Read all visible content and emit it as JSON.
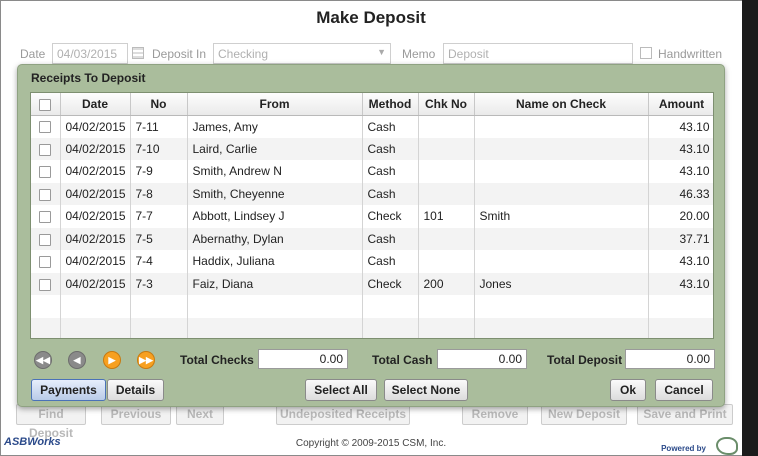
{
  "window": {
    "title": "Make Deposit"
  },
  "form": {
    "date_label": "Date",
    "date_value": "04/03/2015",
    "deposit_in_label": "Deposit In",
    "deposit_in_value": "Checking",
    "memo_label": "Memo",
    "memo_placeholder": "Deposit",
    "handwritten_label": "Handwritten"
  },
  "modal": {
    "title": "Receipts To Deposit",
    "columns": [
      "Date",
      "No",
      "From",
      "Method",
      "Chk No",
      "Name on Check",
      "Amount"
    ],
    "rows": [
      {
        "date": "04/02/2015",
        "no": "7-11",
        "from": "James, Amy",
        "method": "Cash",
        "chk_no": "",
        "name_on_check": "",
        "amount": "43.10"
      },
      {
        "date": "04/02/2015",
        "no": "7-10",
        "from": "Laird, Carlie",
        "method": "Cash",
        "chk_no": "",
        "name_on_check": "",
        "amount": "43.10"
      },
      {
        "date": "04/02/2015",
        "no": "7-9",
        "from": "Smith, Andrew N",
        "method": "Cash",
        "chk_no": "",
        "name_on_check": "",
        "amount": "43.10"
      },
      {
        "date": "04/02/2015",
        "no": "7-8",
        "from": "Smith, Cheyenne",
        "method": "Cash",
        "chk_no": "",
        "name_on_check": "",
        "amount": "46.33"
      },
      {
        "date": "04/02/2015",
        "no": "7-7",
        "from": "Abbott, Lindsey J",
        "method": "Check",
        "chk_no": "101",
        "name_on_check": "Smith",
        "amount": "20.00"
      },
      {
        "date": "04/02/2015",
        "no": "7-5",
        "from": "Abernathy, Dylan",
        "method": "Cash",
        "chk_no": "",
        "name_on_check": "",
        "amount": "37.71"
      },
      {
        "date": "04/02/2015",
        "no": "7-4",
        "from": "Haddix, Juliana",
        "method": "Cash",
        "chk_no": "",
        "name_on_check": "",
        "amount": "43.10"
      },
      {
        "date": "04/02/2015",
        "no": "7-3",
        "from": "Faiz, Diana",
        "method": "Check",
        "chk_no": "200",
        "name_on_check": "Jones",
        "amount": "43.10"
      }
    ],
    "totals": {
      "checks_label": "Total Checks",
      "checks_value": "0.00",
      "cash_label": "Total Cash",
      "cash_value": "0.00",
      "deposit_label": "Total Deposit",
      "deposit_value": "0.00"
    },
    "buttons": {
      "payments": "Payments",
      "details": "Details",
      "select_all": "Select All",
      "select_none": "Select None",
      "ok": "Ok",
      "cancel": "Cancel"
    },
    "pager_icons": [
      "first-page-icon",
      "previous-page-icon",
      "next-page-icon",
      "last-page-icon"
    ]
  },
  "bottom_bar": {
    "find_deposit": "Find Deposit",
    "previous": "Previous",
    "next": "Next",
    "undeposited_receipts": "Undeposited Receipts",
    "remove": "Remove",
    "new_deposit": "New Deposit",
    "save_and_print": "Save and Print"
  },
  "footer": {
    "copyright": "Copyright © 2009-2015 CSM, Inc.",
    "logo_text": "ASBWorks",
    "powered_by": "Powered by"
  },
  "colors": {
    "modal_background": "#aabd9c",
    "active_button": "#b9cbe8",
    "pager_orange": "#f7a020",
    "pager_gray": "#8a8a8a"
  }
}
